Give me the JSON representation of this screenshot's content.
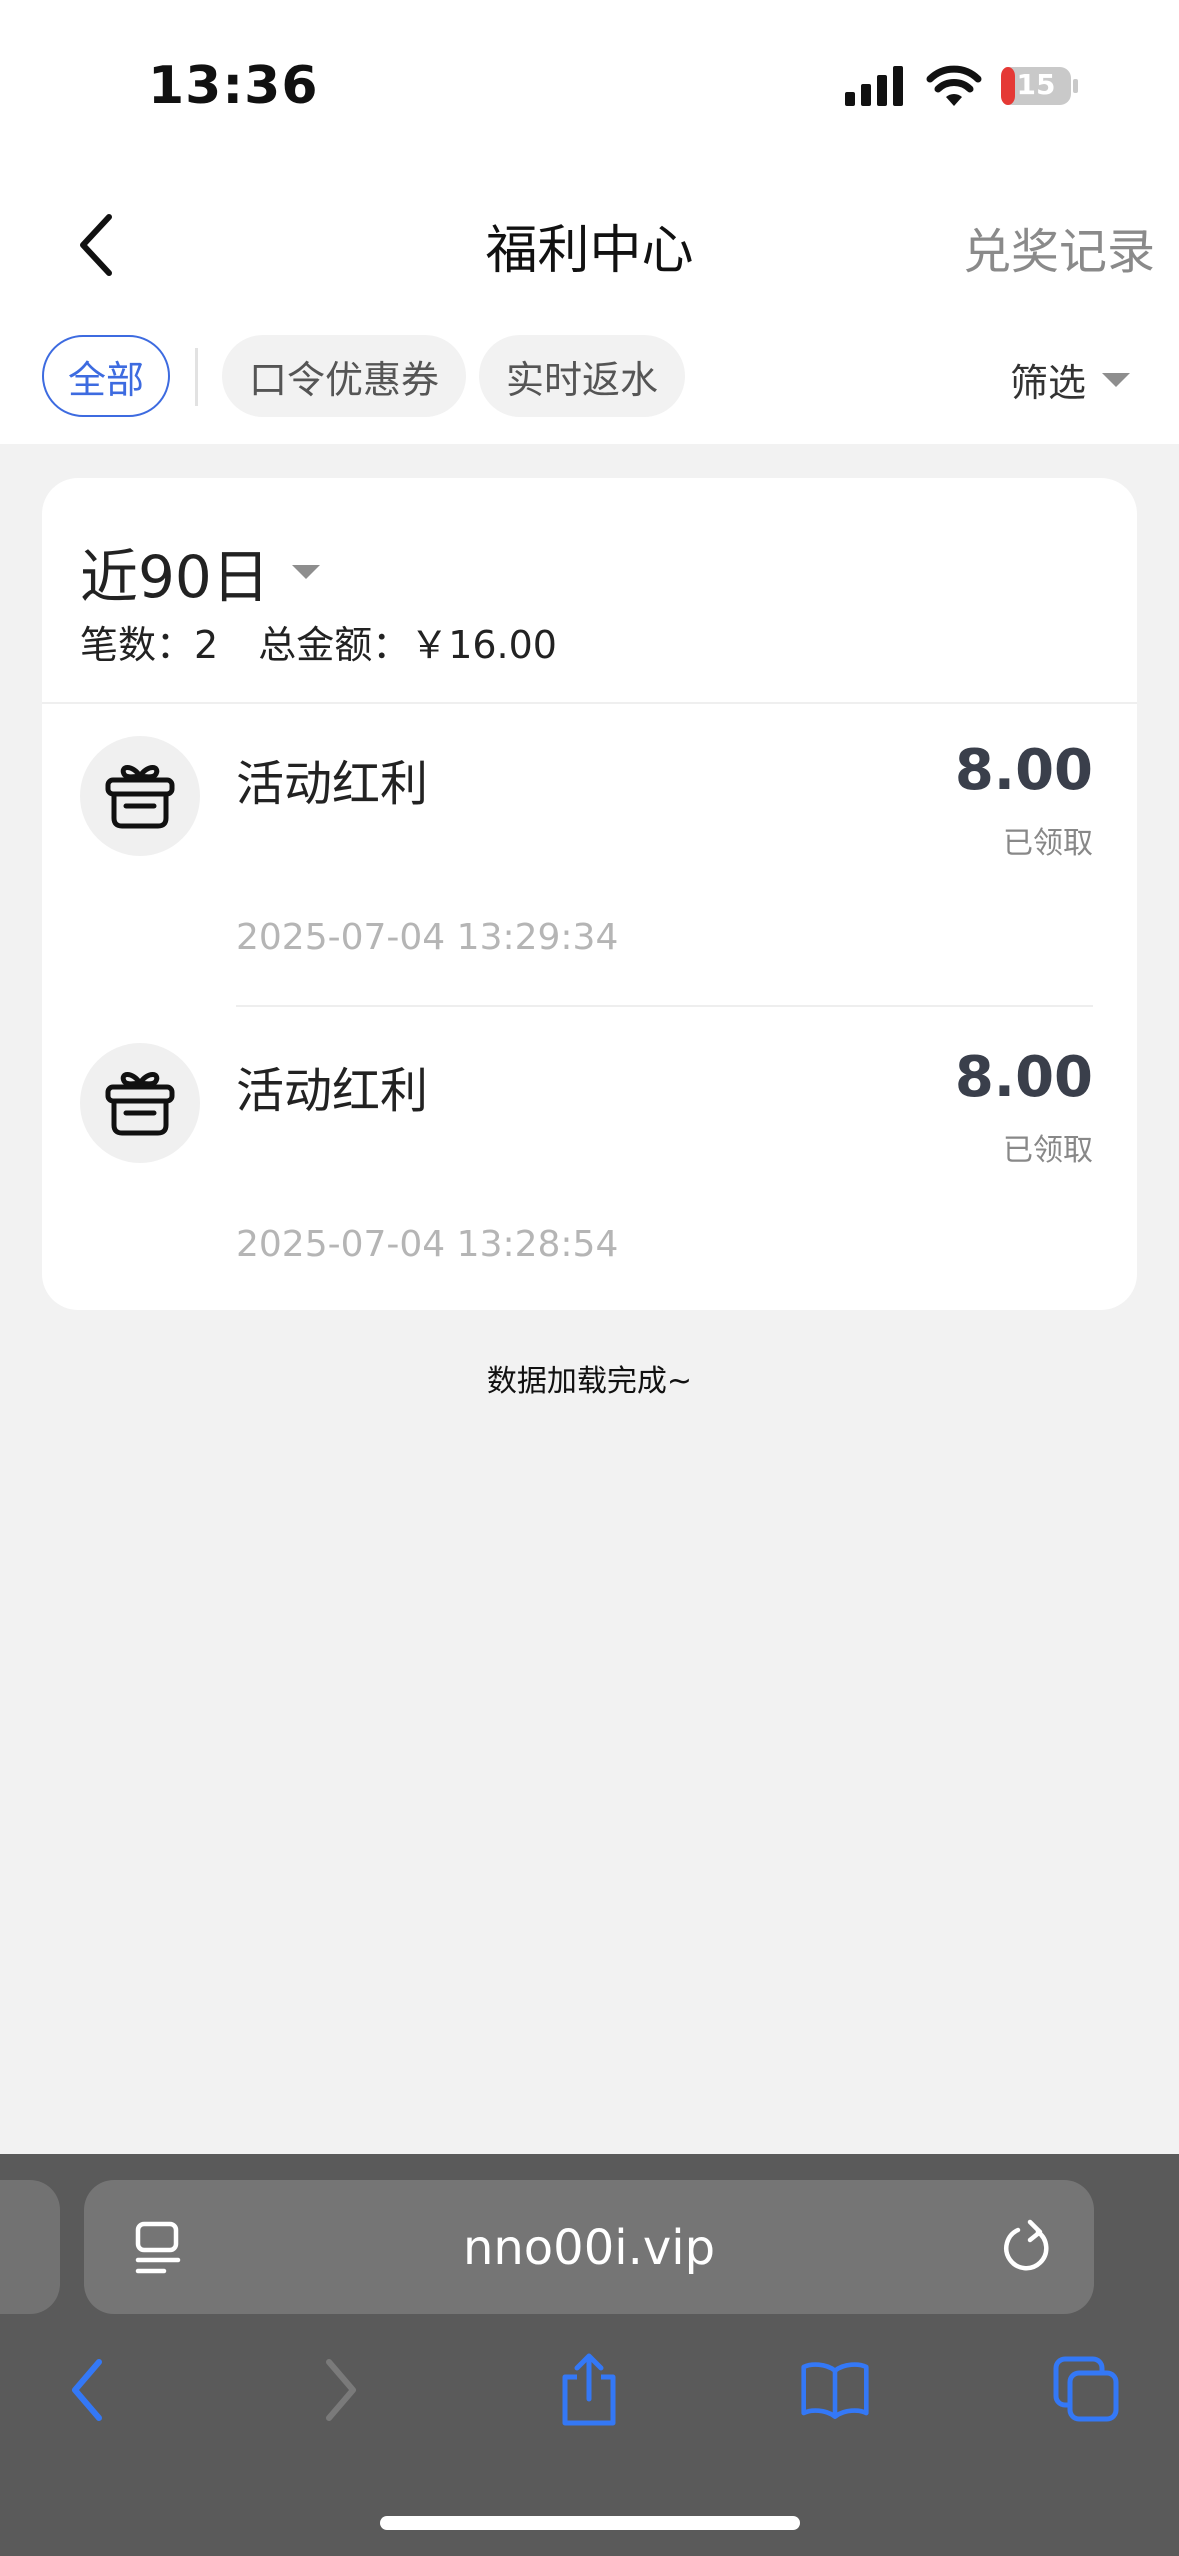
{
  "status_bar": {
    "time": "13:36",
    "battery_level": "15"
  },
  "nav": {
    "title": "福利中心",
    "records_label": "兑奖记录"
  },
  "tabs": [
    {
      "label": "全部",
      "active": true
    },
    {
      "label": "口令优惠券",
      "active": false
    },
    {
      "label": "实时返水",
      "active": false
    }
  ],
  "filter": {
    "label": "筛选"
  },
  "summary": {
    "period_label": "近90日",
    "count_text": "笔数：2",
    "total_text": "总金额：￥16.00"
  },
  "records": [
    {
      "title": "活动红利",
      "amount": "8.00",
      "status": "已领取",
      "time": "2025-07-04 13:29:34"
    },
    {
      "title": "活动红利",
      "amount": "8.00",
      "status": "已领取",
      "time": "2025-07-04 13:28:54"
    }
  ],
  "footer_text": "数据加载完成~",
  "browser": {
    "url": "nno00i.vip"
  },
  "colors": {
    "accent": "#3d6be0",
    "ios_blue": "#3478f6"
  }
}
